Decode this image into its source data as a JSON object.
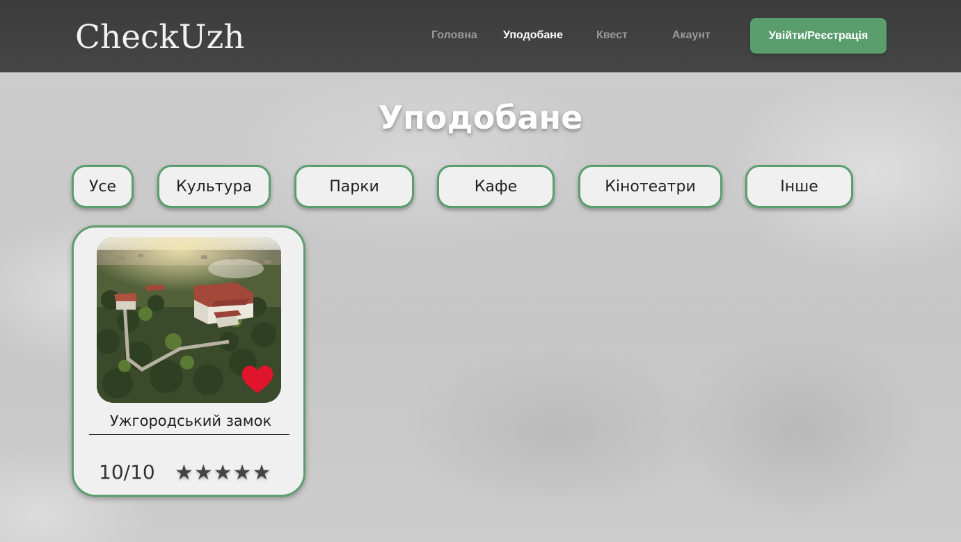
{
  "header": {
    "logo": "CheckUzh",
    "nav": [
      {
        "label": "Головна",
        "active": false
      },
      {
        "label": "Уподобане",
        "active": true
      },
      {
        "label": "Квест",
        "active": false
      },
      {
        "label": "Акаунт",
        "active": false
      }
    ],
    "login_label": "Увійти/Реєстрація"
  },
  "main": {
    "title": "Уподобане",
    "filters": [
      "Усе",
      "Культура",
      "Парки",
      "Кафе",
      "Кінотеатри",
      "Інше"
    ],
    "cards": [
      {
        "title": "Ужгородський замок",
        "score": "10/10",
        "stars": "★★★★★",
        "rating": 5,
        "liked": true,
        "heart_icon": "heart-icon",
        "heart_color": "#e0142b"
      }
    ]
  },
  "colors": {
    "accent": "#5b9e6e",
    "header_bg": "#414141",
    "nav_inactive": "#9a9a9a",
    "nav_active": "#ffffff"
  }
}
